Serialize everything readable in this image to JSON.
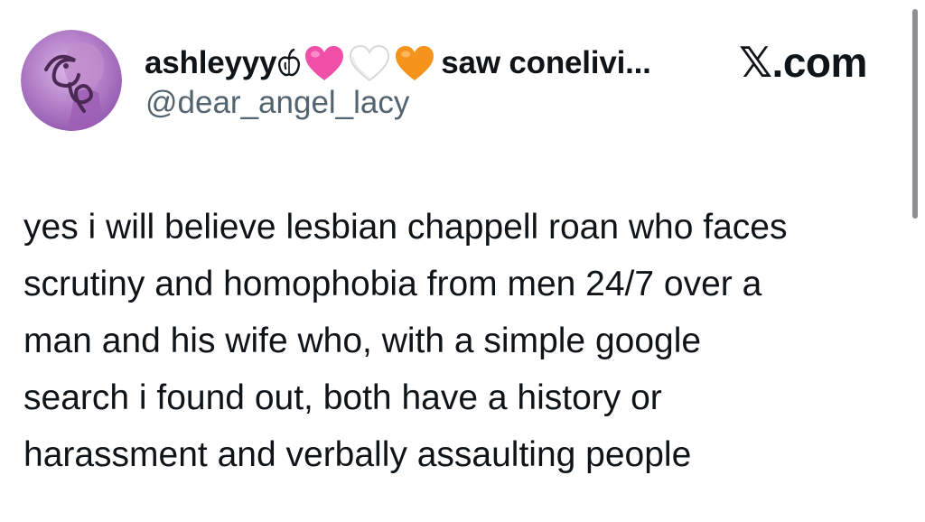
{
  "window": {
    "brand": "𝕏.com"
  },
  "author": {
    "display_name_prefix": "ashleyyy",
    "display_name_suffix": "saw conelivi...",
    "handle": "@dear_angel_lacy",
    "avatar_monogram": "CR",
    "avatar_color": "#b07cc6",
    "emojis": [
      "apple-icon",
      "pink-heart-icon",
      "white-heart-icon",
      "orange-heart-icon"
    ]
  },
  "tweet": {
    "lines": [
      "yes i will believe lesbian chappell roan who faces",
      "scrutiny and homophobia from men 24/7 over a",
      "man and his wife who, with a simple google",
      "search i found out, both have a history or",
      "harassment and verbally assaulting people"
    ]
  },
  "colors": {
    "text": "#0f1419",
    "secondary_text": "#536471",
    "pink_heart": "#f04fa8",
    "orange_heart": "#f6931d",
    "white_heart": "#ffffff"
  }
}
